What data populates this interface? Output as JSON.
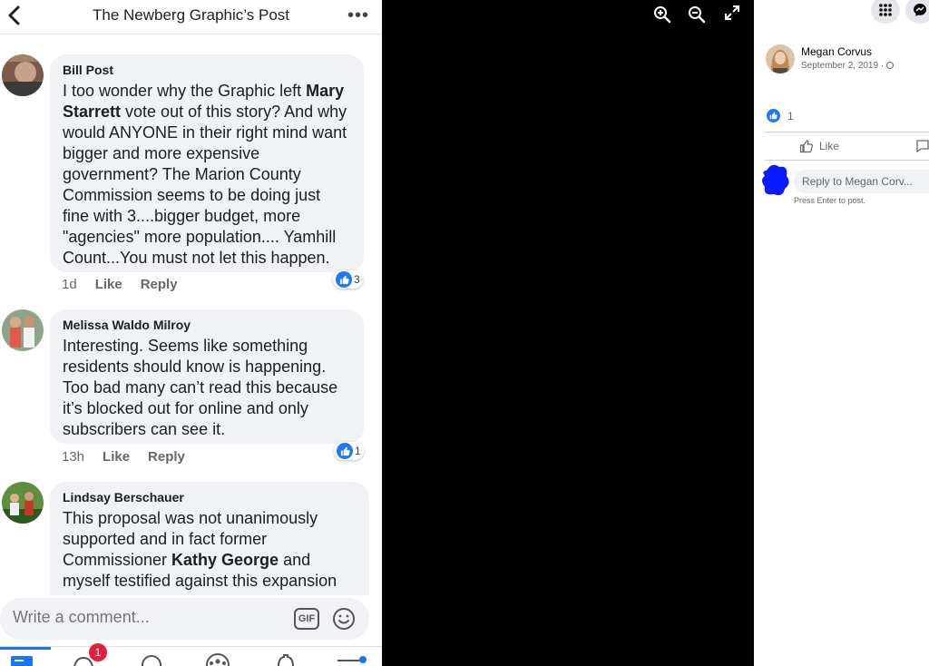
{
  "phone": {
    "header_title": "The Newberg Graphic’s Post",
    "more_label": "•••"
  },
  "comments": [
    {
      "author": "Bill Post",
      "text_parts": [
        "I too wonder why the Graphic left ",
        "Mary Starrett",
        " vote out of this story? And why would ANYONE in their right mind want bigger and more expensive government? The Marion County Commission seems to be doing just fine with 3....bigger budget, more \"agencies\" more population.... Yamhill Count...You must not let this happen."
      ],
      "time": "1d",
      "like_label": "Like",
      "reply_label": "Reply",
      "reactions": "3"
    },
    {
      "author": "Melissa Waldo Milroy",
      "text": "Interesting. Seems like something residents should know is happening. Too bad many can’t read this because it’s blocked out for online and only subscribers can see it.",
      "time": "13h",
      "like_label": "Like",
      "reply_label": "Reply",
      "reactions": "1"
    },
    {
      "author": "Lindsay Berschauer",
      "text_parts": [
        "This proposal was not unanimously supported and in fact former Commissioner ",
        "Kathy George",
        " and myself testified against this expansion"
      ]
    }
  ],
  "composer": {
    "placeholder": "Write a comment...",
    "gif_label": "GIF"
  },
  "tabbar": {
    "notification_badge": "1"
  },
  "right_panel": {
    "author": "Megan Corvus",
    "date": "September 2, 2019 · ",
    "like_count": "1",
    "like_label": "Like",
    "reply_placeholder": "Reply to Megan Corv...",
    "hint": "Press Enter to post."
  },
  "colors": {
    "accent": "#1877f2",
    "bubble": "#f0f2f5",
    "badge": "#e41e3f"
  }
}
